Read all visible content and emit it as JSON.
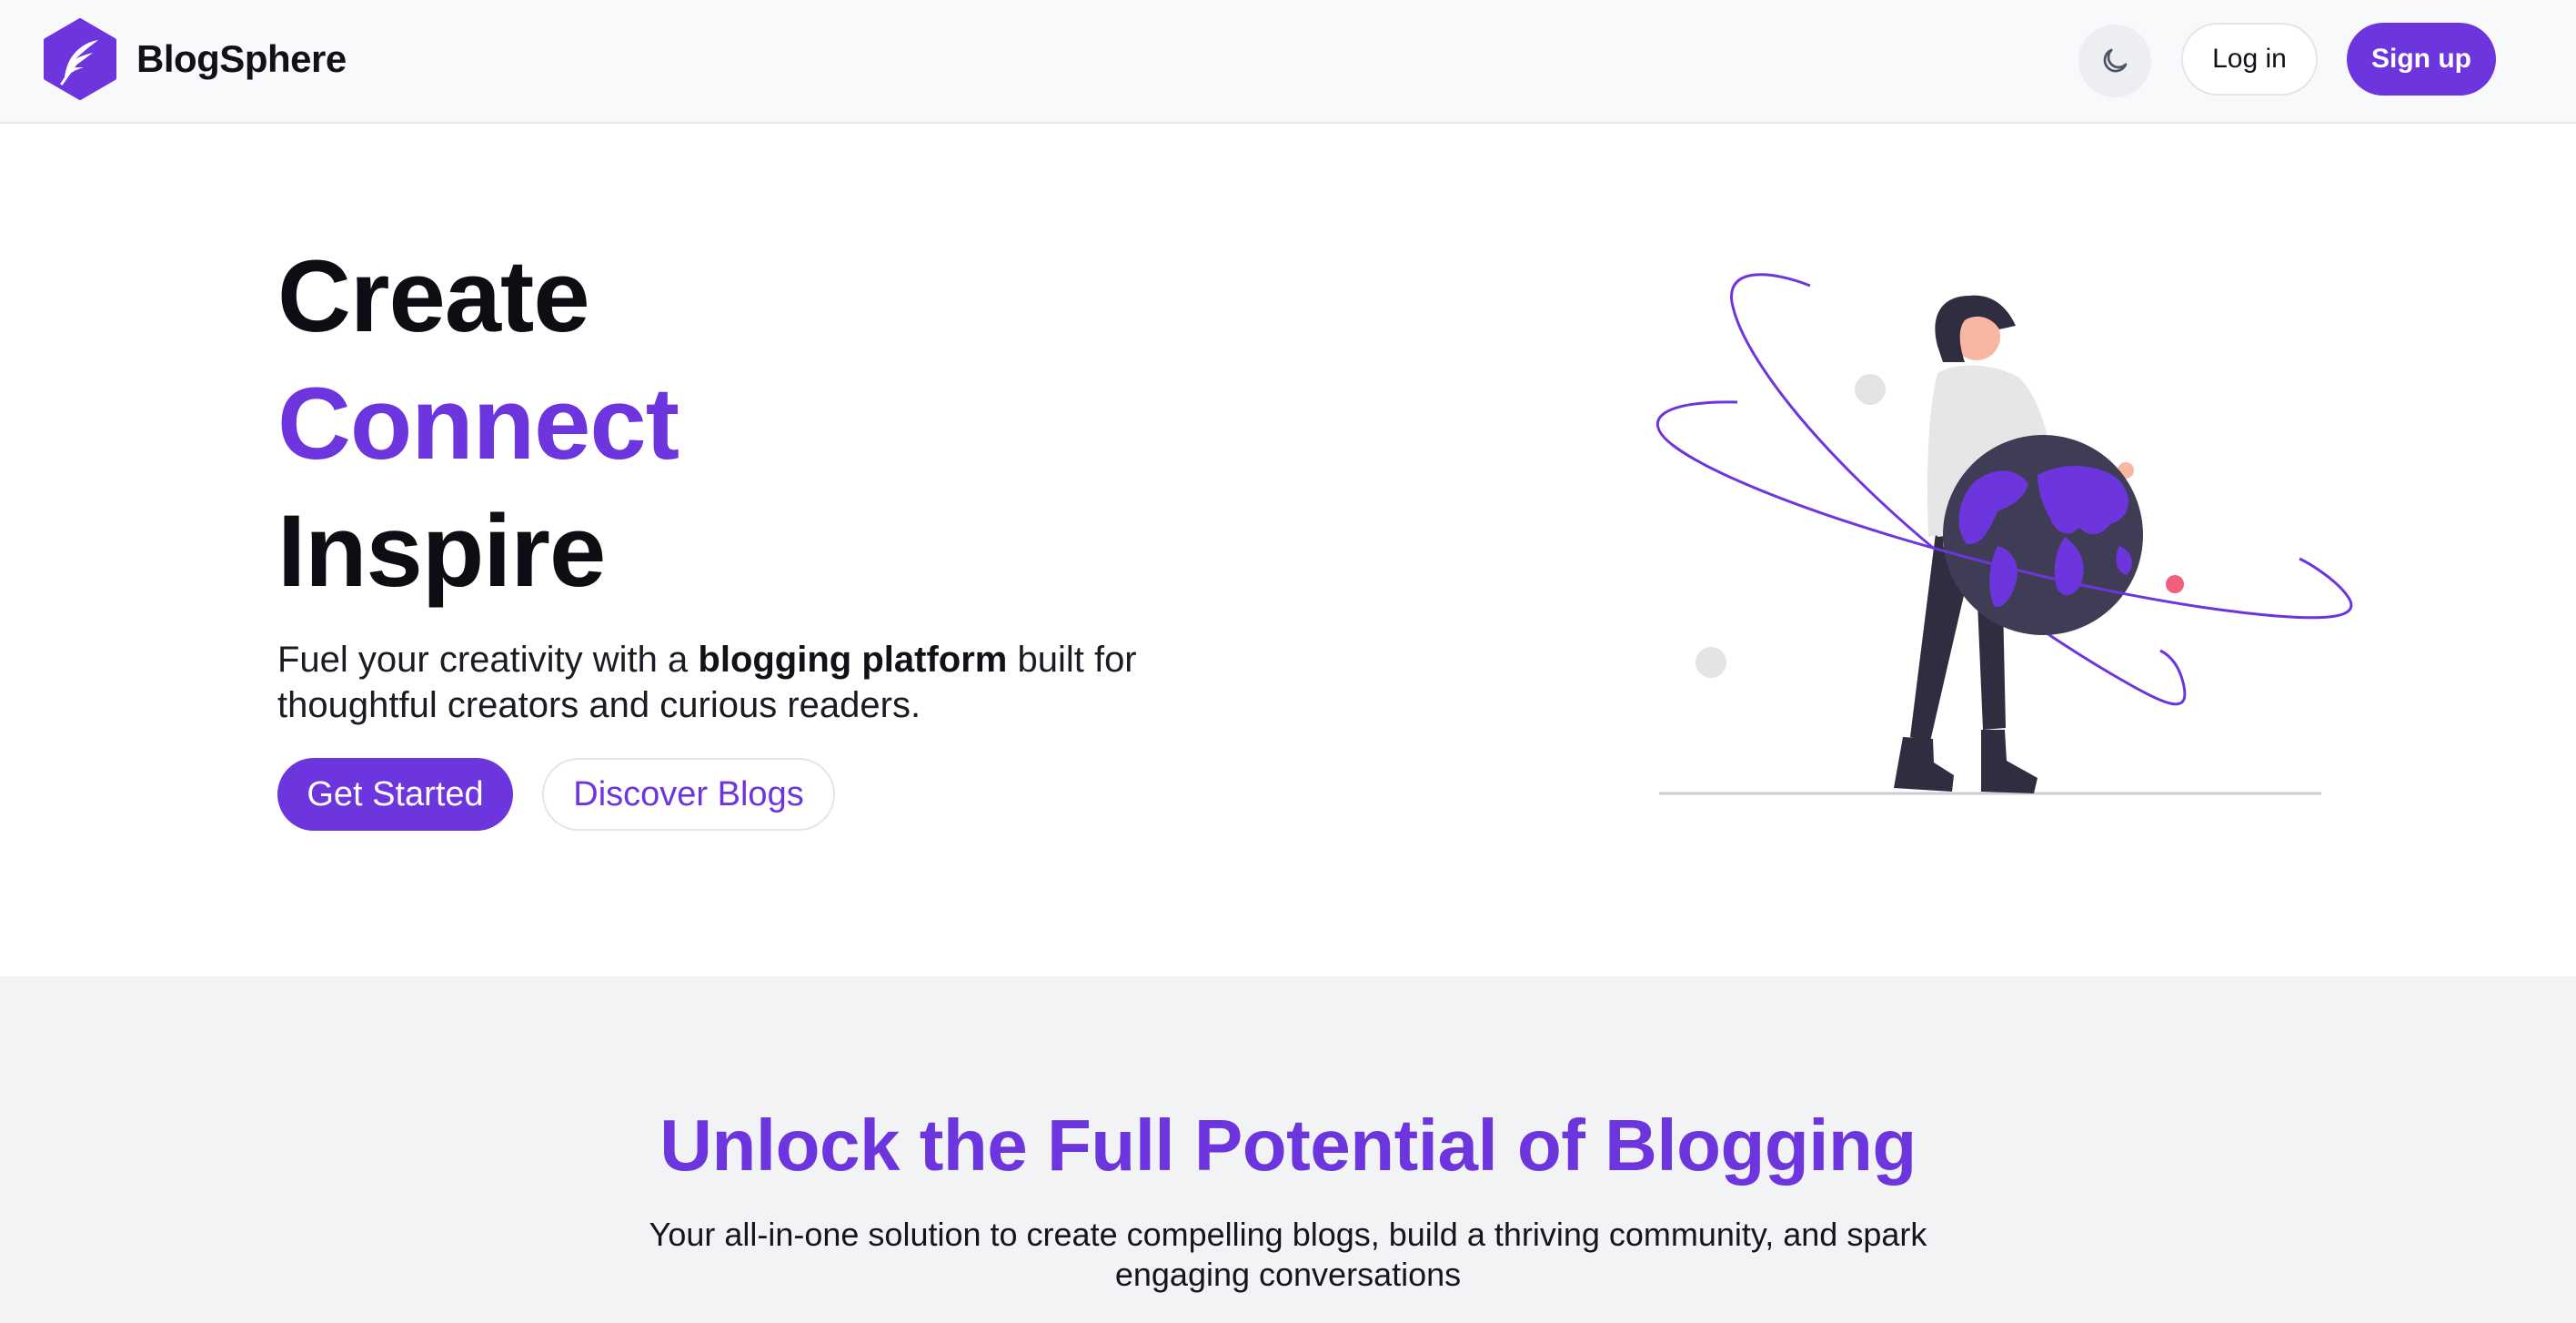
{
  "header": {
    "brand_name": "BlogSphere",
    "login_label": "Log in",
    "signup_label": "Sign up",
    "theme_icon": "moon-icon",
    "logo_icon": "feather-hexagon-icon"
  },
  "hero": {
    "line1": "Create",
    "line2": "Connect",
    "line3": "Inspire",
    "sub_before": "Fuel your creativity with a ",
    "sub_bold": "blogging platform",
    "sub_after": " built for thoughtful creators and curious readers.",
    "primary_cta": "Get Started",
    "secondary_cta": "Discover Blogs",
    "illustration_icon": "person-holding-globe-illustration"
  },
  "features": {
    "title": "Unlock the Full Potential of Blogging",
    "subtitle": "Your all-in-one solution to create compelling blogs, build a thriving community, and spark engaging conversations"
  },
  "colors": {
    "accent": "#6d35dd",
    "header_bg": "#f8f9fa",
    "section_bg": "#f2f3f5",
    "text": "#0f0f17"
  }
}
